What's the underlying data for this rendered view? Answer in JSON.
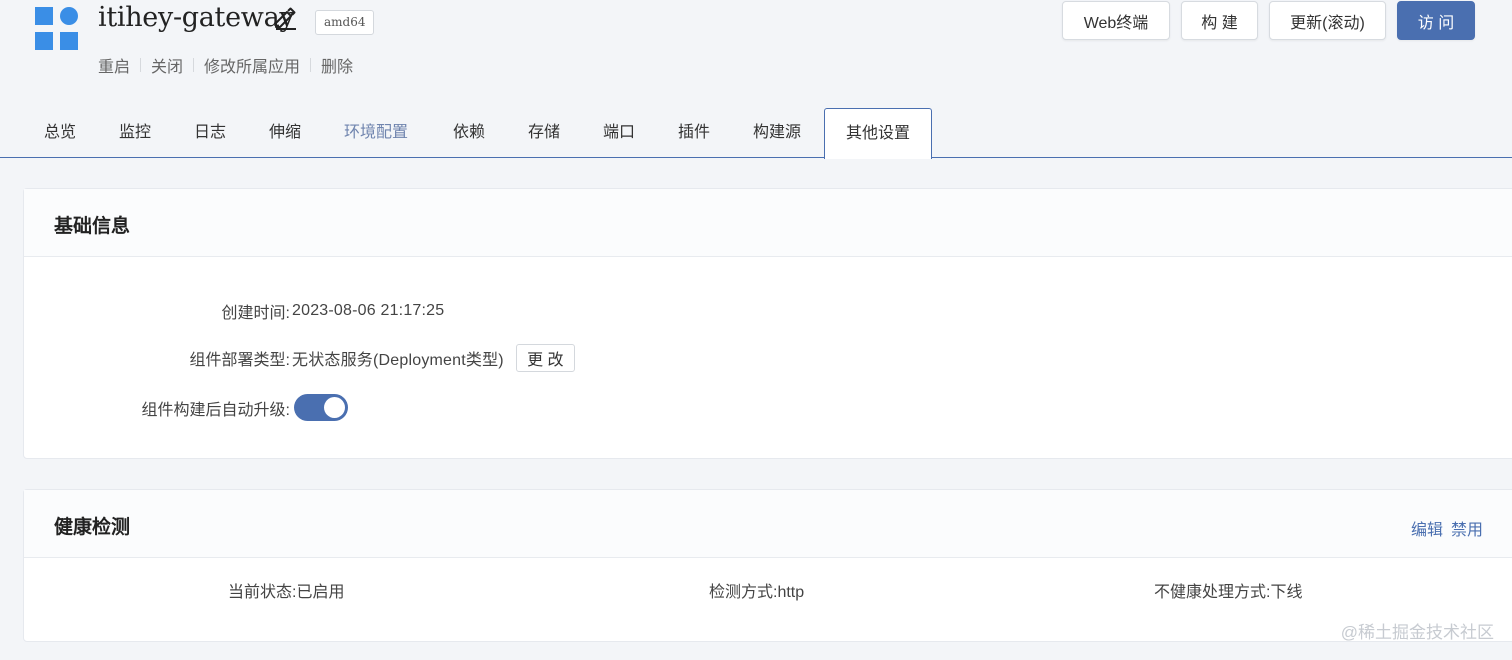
{
  "app": {
    "title": "itihey-gateway",
    "arch": "amd64",
    "icon": "app-grid-icon",
    "edit_icon": "pencil-icon"
  },
  "ops": [
    "重启",
    "关闭",
    "修改所属应用",
    "删除"
  ],
  "header_buttons": {
    "web_terminal": "Web终端",
    "build": "构 建",
    "update": "更新(滚动)",
    "visit": "访 问"
  },
  "tabs": [
    "总览",
    "监控",
    "日志",
    "伸缩",
    "环境配置",
    "依赖",
    "存储",
    "端口",
    "插件",
    "构建源",
    "其他设置"
  ],
  "active_tab": "其他设置",
  "basic_info": {
    "title": "基础信息",
    "created_label": "创建时间:",
    "created_value": "2023-08-06 21:17:25",
    "deploy_type_label": "组件部署类型:",
    "deploy_type_value": "无状态服务(Deployment类型)",
    "change_button": "更 改",
    "auto_upgrade_label": "组件构建后自动升级:",
    "auto_upgrade_on": true
  },
  "health_check": {
    "title": "健康检测",
    "edit_link": "编辑",
    "disable_link": "禁用",
    "status": "当前状态:已启用",
    "method": "检测方式:http",
    "unhealthy_action": "不健康处理方式:下线"
  },
  "watermark": "@稀土掘金技术社区",
  "colors": {
    "primary": "#4a6fb0",
    "logo": "#3a8ee6",
    "bg": "#f3f5f8"
  }
}
